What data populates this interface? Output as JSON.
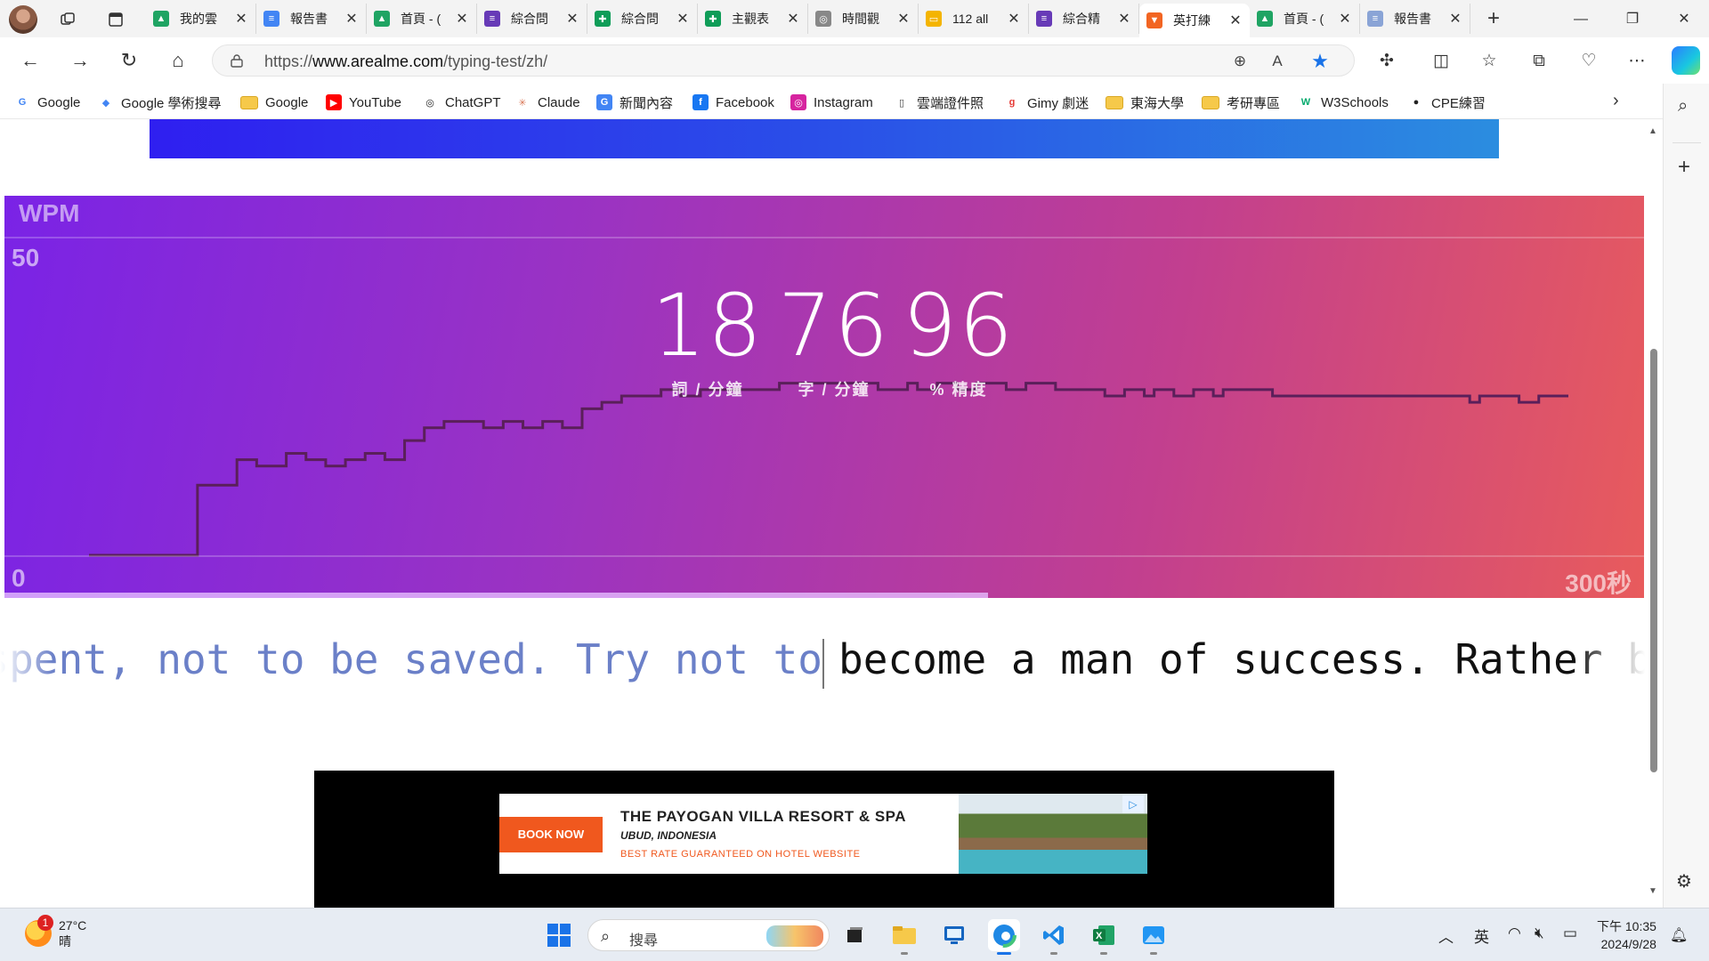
{
  "browser": {
    "tabs": [
      {
        "label": "我的雲",
        "icon": "google-drive-icon",
        "color": "#1fa463"
      },
      {
        "label": "報告書",
        "icon": "google-docs-icon",
        "color": "#4285f4"
      },
      {
        "label": "首頁 - (",
        "icon": "google-drive-icon",
        "color": "#1fa463"
      },
      {
        "label": "綜合問",
        "icon": "google-forms-icon",
        "color": "#673ab7"
      },
      {
        "label": "綜合問",
        "icon": "google-sheets-icon",
        "color": "#0f9d58"
      },
      {
        "label": "主觀表",
        "icon": "google-sheets-icon",
        "color": "#0f9d58"
      },
      {
        "label": "時間觀",
        "icon": "chatgpt-icon",
        "color": "#888888"
      },
      {
        "label": "112 all",
        "icon": "google-slides-icon",
        "color": "#f4b400"
      },
      {
        "label": "綜合精",
        "icon": "google-forms-icon",
        "color": "#673ab7"
      },
      {
        "label": "英打練",
        "icon": "arealme-fox-icon",
        "color": "#f26522",
        "active": true
      },
      {
        "label": "首頁 - (",
        "icon": "google-drive-icon",
        "color": "#1fa463"
      },
      {
        "label": "報告書",
        "icon": "google-docs-icon",
        "color": "#8aa4d6"
      }
    ],
    "url_prefix": "https://",
    "url_host": "www.arealme.com",
    "url_path": "/typing-test/zh/",
    "favorites": [
      {
        "label": "Google",
        "icon": "google-icon"
      },
      {
        "label": "Google 學術搜尋",
        "icon": "google-scholar-icon"
      },
      {
        "label": "Google",
        "icon": "folder-icon"
      },
      {
        "label": "YouTube",
        "icon": "youtube-icon"
      },
      {
        "label": "ChatGPT",
        "icon": "chatgpt-icon"
      },
      {
        "label": "Claude",
        "icon": "claude-icon"
      },
      {
        "label": "新聞內容",
        "icon": "news-icon"
      },
      {
        "label": "Facebook",
        "icon": "facebook-icon"
      },
      {
        "label": "Instagram",
        "icon": "instagram-icon"
      },
      {
        "label": "雲端證件照",
        "icon": "page-icon"
      },
      {
        "label": "Gimy 劇迷",
        "icon": "gimy-icon"
      },
      {
        "label": "東海大學",
        "icon": "folder-icon"
      },
      {
        "label": "考研專區",
        "icon": "folder-icon"
      },
      {
        "label": "W3Schools",
        "icon": "w3schools-icon"
      },
      {
        "label": "CPE練習",
        "icon": "github-icon"
      }
    ]
  },
  "test": {
    "wpm_axis_label": "WPM",
    "y_max": "50",
    "y_min": "0",
    "x_max": "300秒",
    "stats": [
      {
        "value": "18",
        "label": "詞 / 分鐘"
      },
      {
        "value": "76",
        "label": "字 / 分鐘"
      },
      {
        "value": "96",
        "label": "% 精度"
      }
    ],
    "progress": 0.6,
    "typed_text": "Money is to be spent, not to be saved. Try not to",
    "remaining_text": "become a man of success. Rather become a man of value."
  },
  "chart_data": {
    "type": "line",
    "xlabel": "",
    "ylabel": "WPM",
    "xlim": [
      0,
      300
    ],
    "ylim": [
      0,
      50
    ],
    "x_max_label": "300秒",
    "series": [
      {
        "x": [
          0,
          20,
          22,
          30,
          34,
          40,
          44,
          48,
          52,
          56,
          60,
          64,
          68,
          72,
          76,
          80,
          84,
          88,
          92,
          96,
          100,
          104,
          108,
          112,
          116,
          120,
          124,
          128,
          136,
          140,
          150,
          160,
          166,
          168,
          172,
          176,
          180,
          186,
          190,
          196,
          200,
          206,
          210,
          214,
          216,
          220,
          224,
          228,
          230,
          234,
          238,
          240,
          250,
          262,
          276,
          280,
          282,
          286,
          290,
          294,
          300
        ],
        "y": [
          0,
          0,
          11,
          15,
          14,
          16,
          15,
          14,
          15,
          16,
          15,
          18,
          20,
          21,
          21,
          20,
          21,
          20,
          21,
          20,
          23,
          24,
          25,
          25,
          26,
          25,
          26,
          26,
          26,
          27,
          27,
          26,
          27,
          26,
          27,
          26,
          27,
          26,
          27,
          26,
          26,
          25,
          26,
          25,
          26,
          25,
          26,
          25,
          26,
          26,
          26,
          25,
          25,
          25,
          25,
          24,
          25,
          25,
          24,
          25,
          25
        ]
      }
    ]
  },
  "ad": {
    "book_label": "BOOK NOW",
    "title": "THE PAYOGAN VILLA RESORT & SPA",
    "subtitle": "UBUD, INDONESIA",
    "tagline": "BEST RATE GUARANTEED ON HOTEL WEBSITE"
  },
  "taskbar": {
    "temperature": "27°C",
    "weather": "晴",
    "weather_badge": "1",
    "search_placeholder": "搜尋",
    "ime": "英",
    "time": "下午 10:35",
    "date": "2024/9/28"
  }
}
